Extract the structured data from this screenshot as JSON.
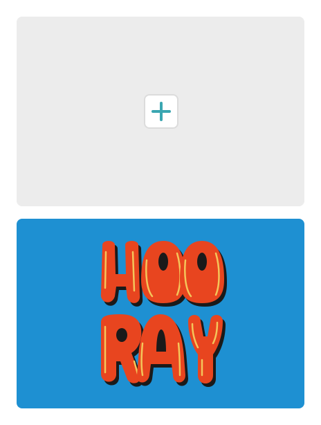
{
  "add_card": {
    "icon": "plus-icon",
    "icon_color": "#3aa6b1",
    "background": "#ececec"
  },
  "design_card": {
    "background": "#1e90d2",
    "headline_lines": [
      "HOO",
      "RAY"
    ],
    "letter_fill": "#e8451f",
    "letter_shadow": "#1a1a1a",
    "letter_highlight": "#f4c55a"
  }
}
